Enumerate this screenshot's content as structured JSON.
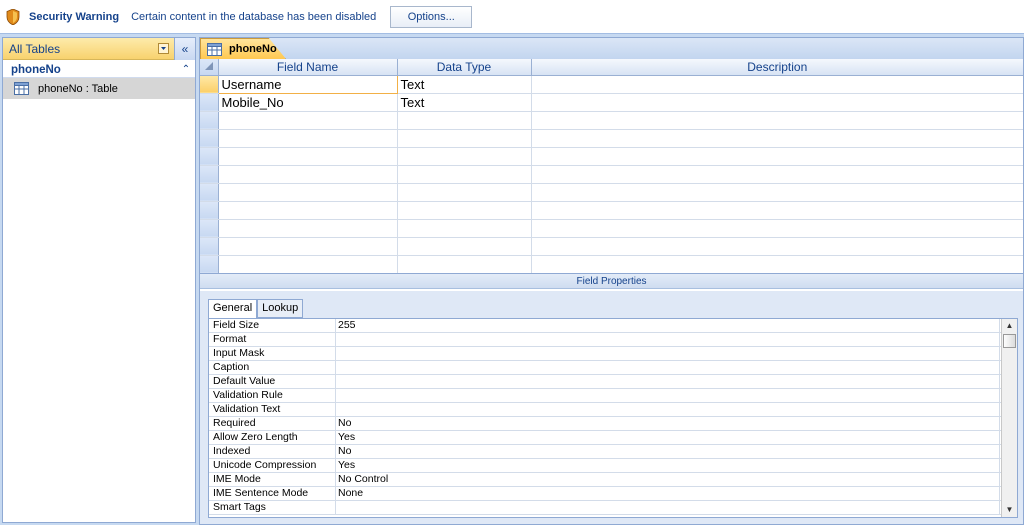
{
  "security_bar": {
    "title": "Security Warning",
    "message": "Certain content in the database has been disabled",
    "options_label": "Options..."
  },
  "nav_pane": {
    "header": "All Tables",
    "collapse_glyph": "«",
    "group": {
      "label": "phoneNo",
      "collapse_glyph": "⌃",
      "items": [
        {
          "label": "phoneNo : Table",
          "icon": "table-icon"
        }
      ]
    }
  },
  "document": {
    "tab_label": "phoneNo",
    "tab_icon": "table-icon",
    "grid": {
      "columns": [
        "Field Name",
        "Data Type",
        "Description"
      ],
      "rows": [
        {
          "field_name": "Username",
          "data_type": "Text",
          "description": ""
        },
        {
          "field_name": "Mobile_No",
          "data_type": "Text",
          "description": ""
        }
      ],
      "empty_rows": 9
    },
    "field_properties": {
      "title": "Field Properties",
      "tabs": [
        "General",
        "Lookup"
      ],
      "active_tab": "General",
      "properties": [
        {
          "name": "Field Size",
          "value": "255"
        },
        {
          "name": "Format",
          "value": ""
        },
        {
          "name": "Input Mask",
          "value": ""
        },
        {
          "name": "Caption",
          "value": ""
        },
        {
          "name": "Default Value",
          "value": ""
        },
        {
          "name": "Validation Rule",
          "value": ""
        },
        {
          "name": "Validation Text",
          "value": ""
        },
        {
          "name": "Required",
          "value": "No"
        },
        {
          "name": "Allow Zero Length",
          "value": "Yes"
        },
        {
          "name": "Indexed",
          "value": "No"
        },
        {
          "name": "Unicode Compression",
          "value": "Yes"
        },
        {
          "name": "IME Mode",
          "value": "No Control"
        },
        {
          "name": "IME Sentence Mode",
          "value": "None"
        },
        {
          "name": "Smart Tags",
          "value": ""
        }
      ]
    }
  },
  "colors": {
    "accent": "#15428b",
    "selection": "#fbcf69",
    "border": "#8fa9d3"
  }
}
